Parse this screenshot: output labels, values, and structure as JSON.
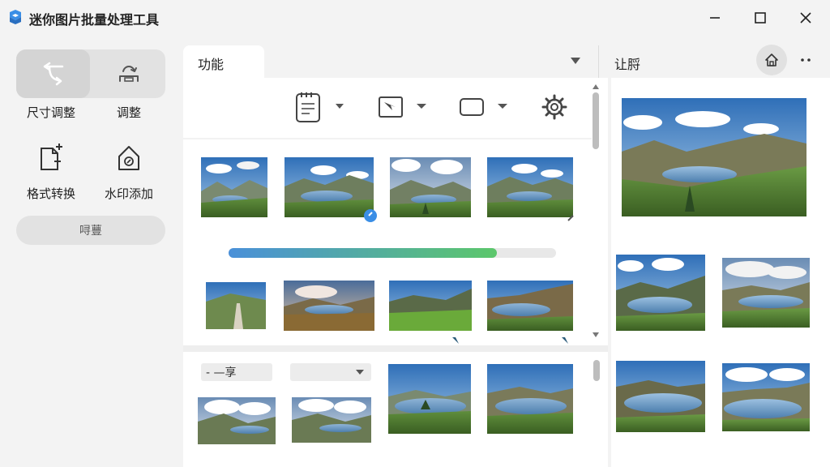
{
  "app": {
    "title": "迷你图片批量处理工具",
    "accent": "#3a8ee6"
  },
  "window": {
    "minimize_icon": "minimize-icon",
    "maximize_icon": "maximize-icon",
    "close_icon": "close-icon"
  },
  "sidebar": {
    "segment": [
      {
        "icon": "resize-arrows-icon",
        "active": true
      },
      {
        "icon": "adjust-arrows-icon",
        "active": false
      }
    ],
    "segment_labels": [
      "尺寸调整",
      "调整"
    ],
    "tools": [
      {
        "label": "格式转换",
        "icon": "file-plus-icon"
      },
      {
        "label": "水印添加",
        "icon": "watermark-house-icon"
      }
    ],
    "pill_label": "㖊蘴"
  },
  "center": {
    "tab_label": "功能",
    "toolbar_icons": [
      "notepad-icon",
      "image-crop-icon",
      "rectangle-icon",
      "gear-icon"
    ],
    "progress": 0.82,
    "progress_colors": [
      "#4a90d9",
      "#5cc76b"
    ],
    "bottom_dropdown_text": "- —享"
  },
  "right": {
    "title": "让脟"
  }
}
